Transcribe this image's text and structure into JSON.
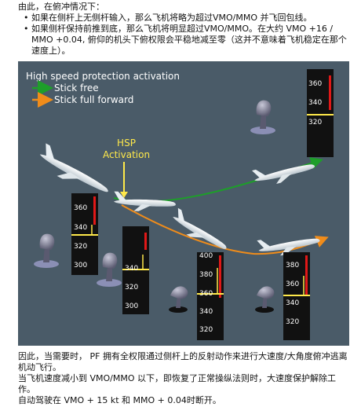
{
  "intro": {
    "heading": "由此，在俯冲情况下：",
    "bullets": [
      "如果在侧杆上无侧杆输入，那么飞机将略为超过VMO/MMO 并飞回包线。",
      "如果侧杆保持前推到底，那么飞机将明显超过VMO/MMO。在大约 VMO +16 / MMO +0.04, 俯仰的机头下俯权限会平稳地减至零（这并不意味着飞机稳定在那个速度上）。"
    ]
  },
  "diagram": {
    "title": "High speed protection activation",
    "legend": [
      {
        "label": "Stick free",
        "color": "#1e9e2a"
      },
      {
        "label": "Stick full forward",
        "color": "#f08c1a"
      }
    ],
    "hsp_label_1": "HSP",
    "hsp_label_2": "Activation",
    "tapes": {
      "top_right": [
        "360",
        "340",
        "320"
      ],
      "left": [
        "360",
        "340",
        "320",
        "300"
      ],
      "second": [
        "340",
        "320",
        "300"
      ],
      "third": [
        "400",
        "380",
        "360",
        "340",
        "320"
      ],
      "right": [
        "380",
        "360",
        "340",
        "320"
      ]
    },
    "colors": {
      "panel": "#4a5b68",
      "stick_free": "#1e9e2a",
      "stick_forward": "#f08c1a",
      "hsp": "#ffe94a",
      "overspeed": "#e01818"
    }
  },
  "footer": {
    "p1": "因此，当需要时， PF 拥有全权限通过侧杆上的反射动作来进行大速度/大角度俯冲逃离机动飞行。",
    "p2": "当飞机速度减小到 VMO/MMO 以下，即恢复了正常操纵法则时，大速度保护解除工作。",
    "p3": "自动驾驶在 VMO + 15 kt 和 MMO + 0.04时断开。"
  }
}
